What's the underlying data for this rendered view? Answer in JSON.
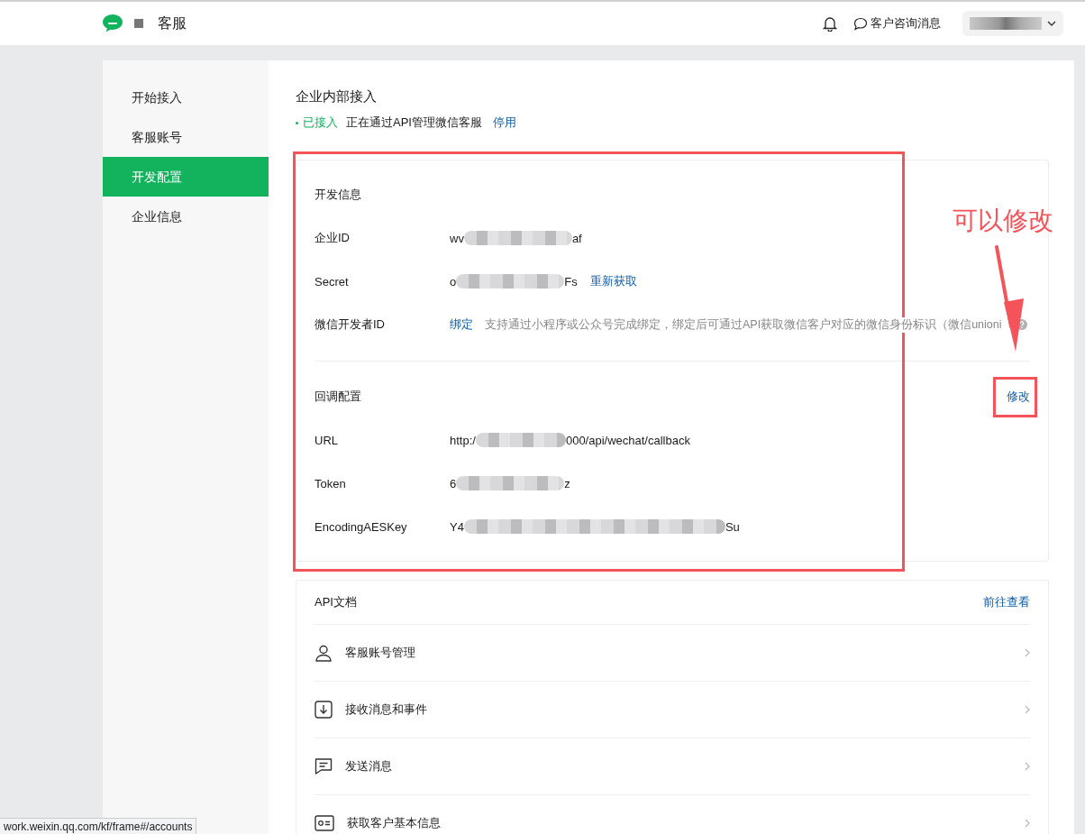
{
  "topbar": {
    "title": "客服",
    "messages": "客户咨询消息"
  },
  "sidebar": {
    "items": [
      {
        "label": "开始接入",
        "selected": false
      },
      {
        "label": "客服账号",
        "selected": false
      },
      {
        "label": "开发配置",
        "selected": true
      },
      {
        "label": "企业信息",
        "selected": false
      }
    ]
  },
  "header": {
    "title": "企业内部接入",
    "status": "已接入",
    "description": "正在通过API管理微信客服",
    "action": "停用"
  },
  "dev_info": {
    "title": "开发信息",
    "fields": [
      {
        "kind": "masked",
        "label": "企业ID",
        "value_start": "wv",
        "value_end": "af"
      },
      {
        "kind": "masked",
        "label": "Secret",
        "value_start": "o",
        "value_end": "Fs",
        "action": "重新获取"
      },
      {
        "kind": "bind",
        "label": "微信开发者ID",
        "action": "绑定",
        "hint": "支持通过小程序或公众号完成绑定，绑定后可通过API获取微信客户对应的微信身份标识（微信unioni"
      }
    ]
  },
  "callback": {
    "title": "回调配置",
    "action": "修改",
    "fields": [
      {
        "kind": "masked",
        "label": "URL",
        "value_start": "http:/",
        "value_end": "000/api/wechat/callback"
      },
      {
        "kind": "masked",
        "label": "Token",
        "value_start": "6",
        "value_end": "z"
      },
      {
        "kind": "masked",
        "label": "EncodingAESKey",
        "value_start": "Y4",
        "value_end": "Su"
      }
    ]
  },
  "api_docs": {
    "title": "API文档",
    "link": "前往查看",
    "items": [
      {
        "kind": "account",
        "label": "客服账号管理"
      },
      {
        "kind": "receive",
        "label": "接收消息和事件"
      },
      {
        "kind": "send",
        "label": "发送消息"
      },
      {
        "kind": "profile",
        "label": "获取客户基本信息"
      }
    ]
  },
  "annotation": {
    "text": "可以修改"
  },
  "status_bar": {
    "url": "work.weixin.qq.com/kf/frame#/accounts"
  }
}
